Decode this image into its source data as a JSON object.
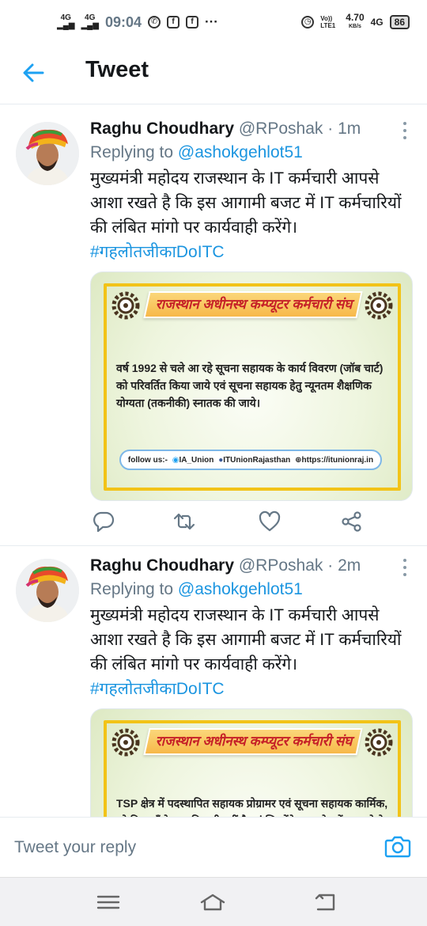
{
  "status_bar": {
    "net1": "4G",
    "net2": "4G",
    "time": "09:04",
    "more": "···",
    "volte": "Vo)) LTE1",
    "speed": "4.70",
    "speed_unit": "KB/s",
    "net3": "4G",
    "battery": "86"
  },
  "header": {
    "title": "Tweet"
  },
  "tweets": [
    {
      "name": "Raghu Choudhary",
      "handle": "@RPoshak",
      "dot": "·",
      "time": "1m",
      "replying_prefix": "Replying to ",
      "replying_to": "@ashokgehlot51",
      "text": "मुख्यमंत्री महोदय राजस्थान के IT कर्मचारी आपसे आशा रखते है कि इस आगामी बजट में IT कर्मचारियों की लंबित मांगो पर कार्यवाही करेंगे।",
      "hashtag": "#गहलोतजीकाDoITC",
      "card": {
        "banner": "राजस्थान अधीनस्थ कम्प्यूटर कर्मचारी संघ",
        "body": "वर्ष 1992 से चले आ रहे सूचना  सहायक के कार्य विवरण (जॉब चार्ट) को परिवर्तित किया जाये एवं सूचना सहायक हेतु न्यूनतम शैक्षणिक योग्यता (तकनीकी) स्नातक की जाये।",
        "follow_label": "follow us:-",
        "twitter": "IA_Union",
        "facebook": "ITUnionRajasthan",
        "website": "https://itunionraj.in"
      }
    },
    {
      "name": "Raghu Choudhary",
      "handle": "@RPoshak",
      "dot": "·",
      "time": "2m",
      "replying_prefix": "Replying to ",
      "replying_to": "@ashokgehlot51",
      "text": "मुख्यमंत्री महोदय राजस्थान के IT कर्मचारी आपसे आशा रखते है कि इस आगामी बजट में IT कर्मचारियों की लंबित मांगो पर कार्यवाही करेंगे।",
      "hashtag": "#गहलोतजीकाDoITC",
      "card": {
        "banner": "राजस्थान अधीनस्थ कम्प्यूटर कर्मचारी संघ",
        "body": "TSP क्षेत्र में पदस्थापित सहायक प्रोग्रामर एवं सूचना सहायक कार्मिक, जो कि वहाँ के मूल निवासी नहीं है एवं जिन्होंने उक्त क्षेत्र में ना रहने के"
      }
    }
  ],
  "reply_bar": {
    "placeholder": "Tweet your reply"
  },
  "colors": {
    "accent": "#1b95e0",
    "secondary_text": "#657786",
    "frame": "#f2c318",
    "banner_text": "#c62128"
  }
}
